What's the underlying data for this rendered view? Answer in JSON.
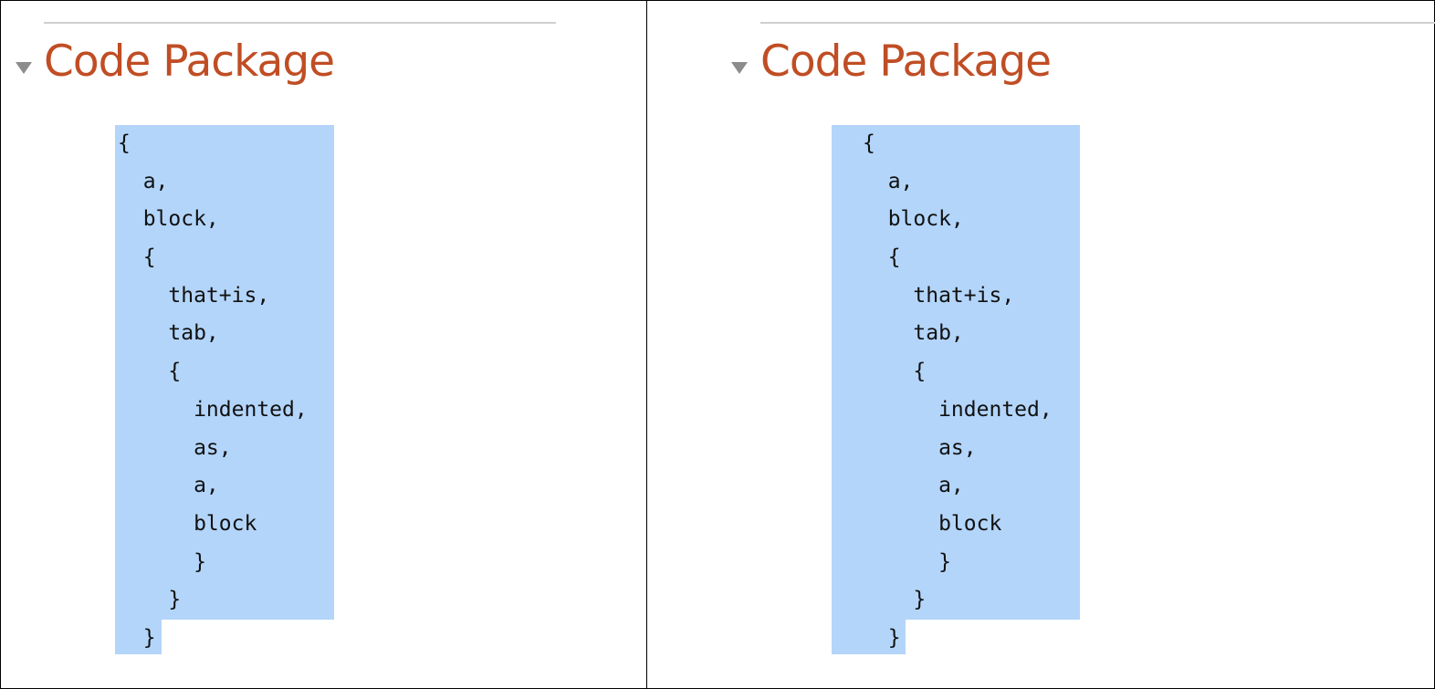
{
  "panels": [
    {
      "id": "left",
      "heading": "Code Package",
      "code_lines": [
        "{",
        "  a,",
        "  block,",
        "  {",
        "    that+is,",
        "    tab,",
        "    {",
        "      indented,",
        "      as,",
        "      a,",
        "      block",
        "      }",
        "    }",
        "  }"
      ]
    },
    {
      "id": "right",
      "heading": "Code Package",
      "code_lines": [
        "{",
        "  a,",
        "  block,",
        "  {",
        "    that+is,",
        "    tab,",
        "    {",
        "      indented,",
        "      as,",
        "      a,",
        "      block",
        "      }",
        "    }",
        "  }"
      ]
    }
  ],
  "colors": {
    "heading": "#c04d24",
    "selection": "#b3d5fa",
    "disclosure": "#8c8c8c",
    "rule": "#cfcfcf"
  },
  "icons": {
    "disclosure": "disclosure-triangle-icon"
  }
}
